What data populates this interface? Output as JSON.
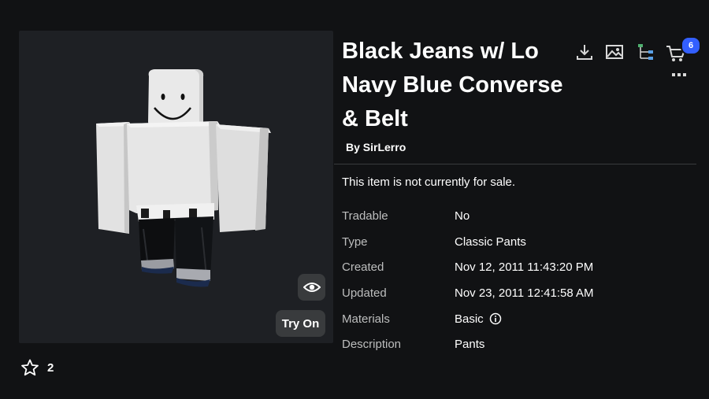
{
  "item": {
    "title": "Black Jeans w/ Lo Navy Blue Converse & Belt",
    "by_label": "By SirLerro",
    "sale_status": "This item is not currently for sale."
  },
  "preview": {
    "try_on_label": "Try On",
    "eye_icon": "eye-icon"
  },
  "favorites": {
    "count": "2",
    "icon": "star-outline-icon"
  },
  "toolbar": {
    "icons": [
      "download-icon",
      "image-icon",
      "hierarchy-icon",
      "cart-icon",
      "more-icon"
    ],
    "cart_badge": "6",
    "accent": "#335fff"
  },
  "details": [
    {
      "label": "Tradable",
      "value": "No"
    },
    {
      "label": "Type",
      "value": "Classic Pants"
    },
    {
      "label": "Created",
      "value": "Nov 12, 2011 11:43:20 PM"
    },
    {
      "label": "Updated",
      "value": "Nov 23, 2011 12:41:58 AM"
    },
    {
      "label": "Materials",
      "value": "Basic",
      "icon": "info-icon"
    },
    {
      "label": "Description",
      "value": "Pants"
    }
  ]
}
